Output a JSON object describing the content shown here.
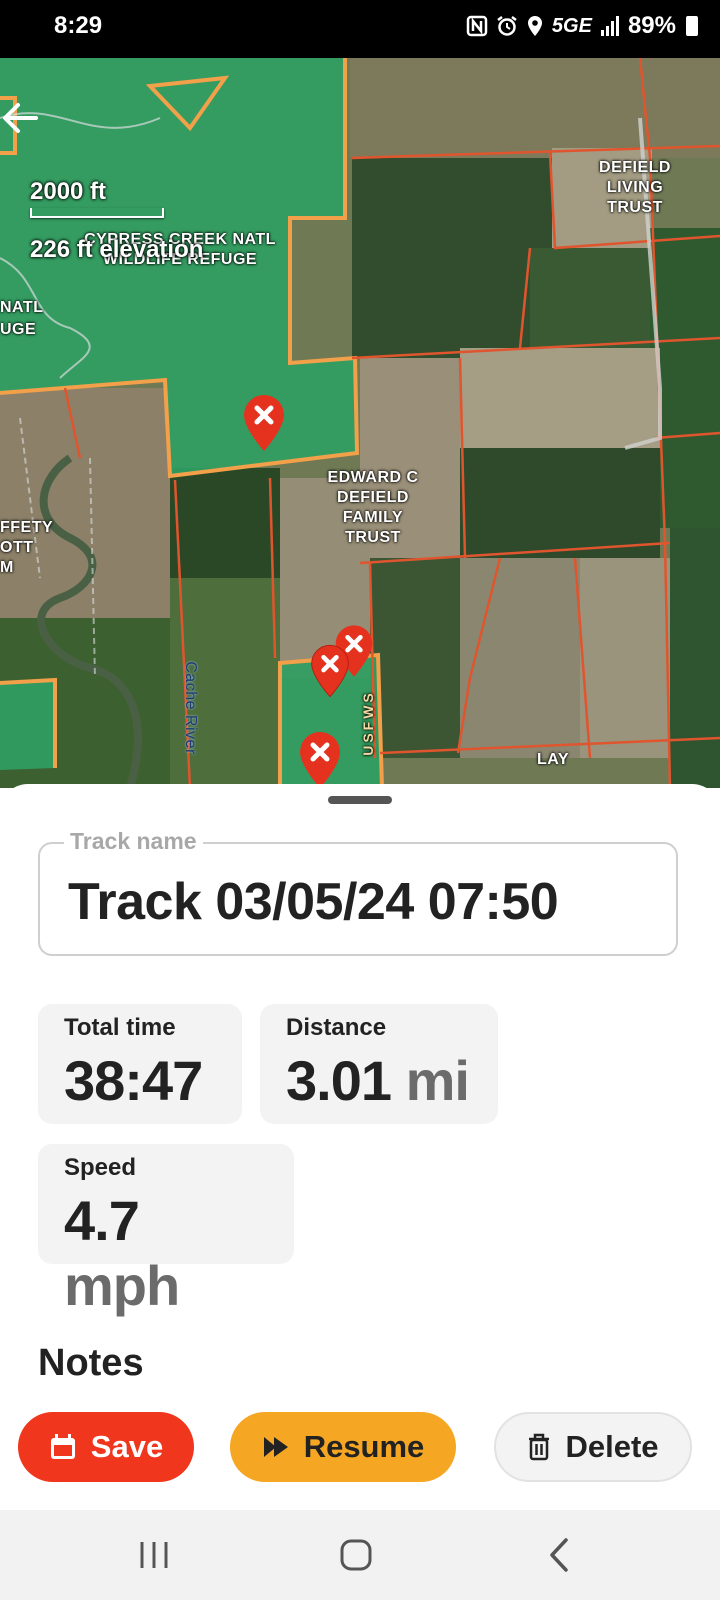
{
  "status_bar": {
    "time": "8:29",
    "network": "5GE",
    "battery_percent": "89%",
    "icons": [
      "nfc-icon",
      "alarm-icon",
      "location-icon",
      "signal-icon",
      "battery-icon"
    ]
  },
  "map": {
    "scale_distance": "2000 ft",
    "elevation": "226 ft elevation",
    "labels": {
      "cypress_creek": "CYPRESS CREEK NATL WILDLIFE REFUGE",
      "natl_fragment": "NATL",
      "uge_fragment": "UGE",
      "defield_living": "DEFIELD LIVING TRUST",
      "edward_defield": "EDWARD C DEFIELD FAMILY TRUST",
      "affety_fragment": "FFETY",
      "ott_fragment": "OTT",
      "m_fragment": "M",
      "usfws": "USFWS",
      "cache_river": "Cache River",
      "lay": "LAY"
    },
    "colors": {
      "refuge_green": "#2f9e62",
      "parcel_line": "#e0552e",
      "refuge_border": "#f2a04a",
      "marker_red": "#e4321f"
    }
  },
  "track": {
    "name_label": "Track name",
    "name_value": "Track 03/05/24 07:50"
  },
  "stats": {
    "total_time": {
      "label": "Total time",
      "value": "38:47"
    },
    "distance": {
      "label": "Distance",
      "value": "3.01",
      "unit": "mi"
    },
    "speed": {
      "label": "Speed",
      "value": "4.7",
      "unit": "mph"
    }
  },
  "notes": {
    "title": "Notes"
  },
  "actions": {
    "save": "Save",
    "resume": "Resume",
    "delete": "Delete",
    "colors": {
      "save": "#f0361c",
      "resume": "#f5a623",
      "delete": "#f3f3f3"
    }
  },
  "nav_bar": {
    "buttons": [
      "recents-icon",
      "home-icon",
      "back-icon"
    ]
  }
}
